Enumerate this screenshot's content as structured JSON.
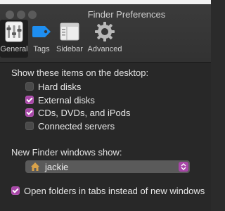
{
  "window": {
    "title": "Finder Preferences"
  },
  "toolbar": {
    "tabs": [
      {
        "label": "General",
        "icon": "general-icon",
        "active": true
      },
      {
        "label": "Tags",
        "icon": "tag-icon",
        "active": false
      },
      {
        "label": "Sidebar",
        "icon": "sidebar-icon",
        "active": false
      },
      {
        "label": "Advanced",
        "icon": "gear-icon",
        "active": false
      }
    ]
  },
  "desktop": {
    "heading": "Show these items on the desktop:",
    "items": [
      {
        "label": "Hard disks",
        "checked": false
      },
      {
        "label": "External disks",
        "checked": true
      },
      {
        "label": "CDs, DVDs, and iPods",
        "checked": true
      },
      {
        "label": "Connected servers",
        "checked": false
      }
    ]
  },
  "new_window": {
    "heading": "New Finder windows show:",
    "selected": "jackie"
  },
  "tabs_option": {
    "label": "Open folders in tabs instead of new windows",
    "checked": true
  },
  "colors": {
    "accent": "#a847a8",
    "background": "#282828",
    "toolbar": "#363636"
  }
}
